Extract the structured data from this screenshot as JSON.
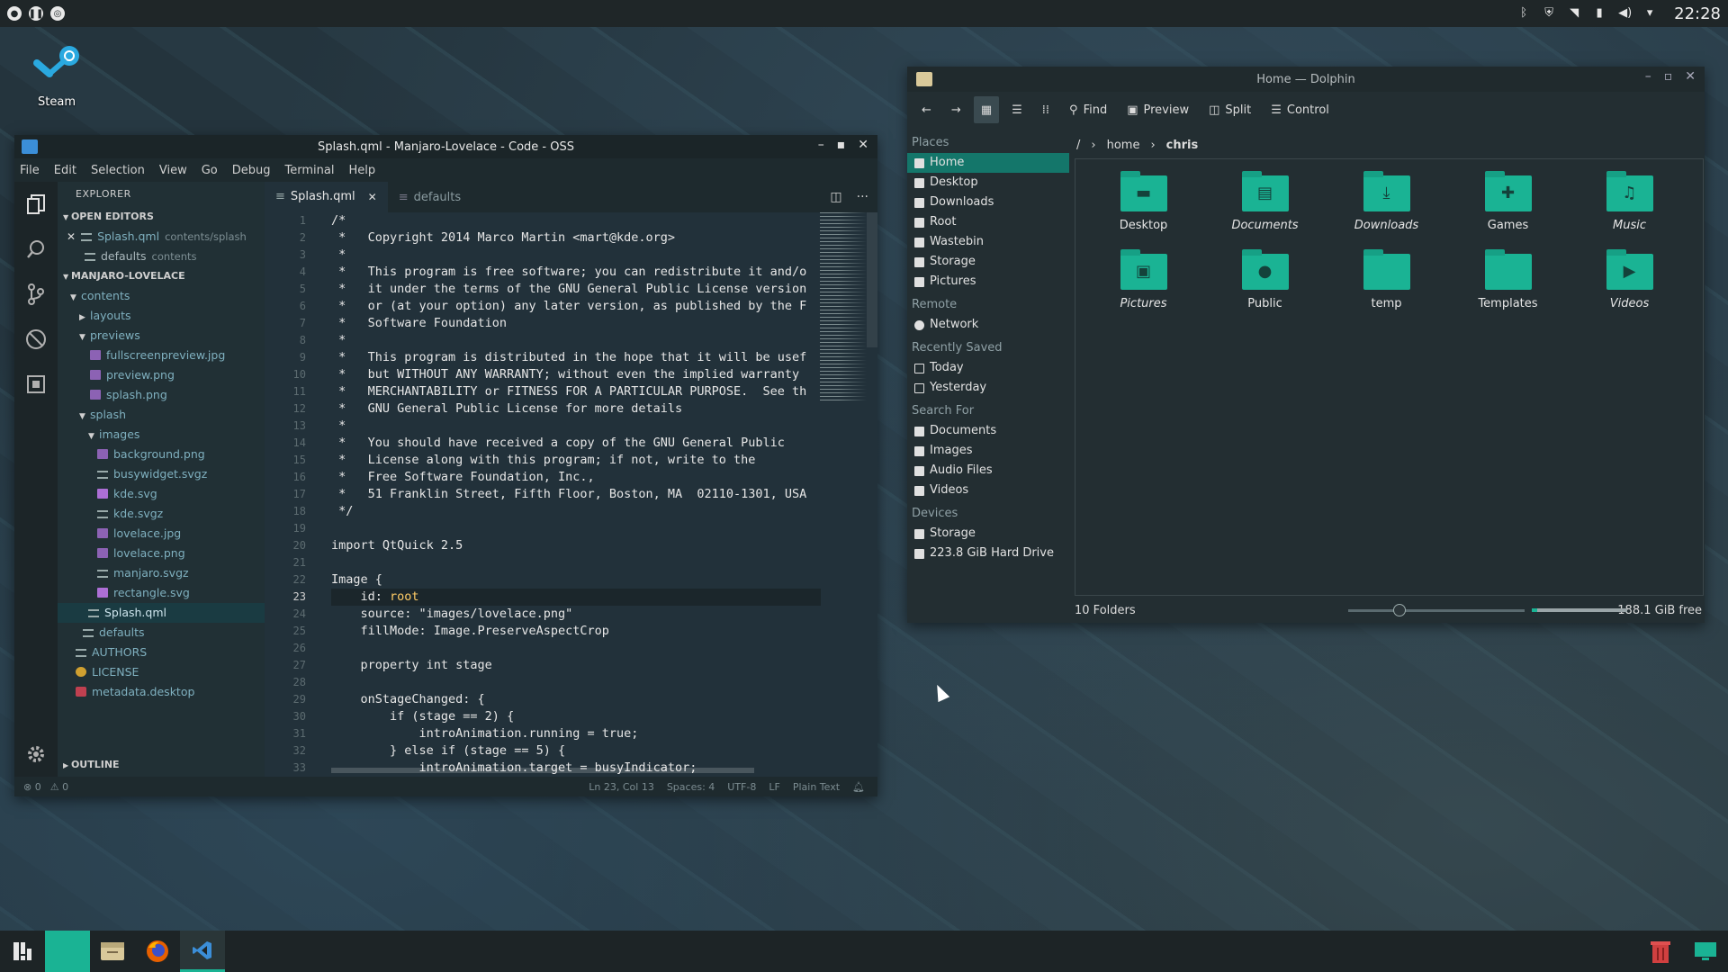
{
  "top_panel": {
    "clock": "22:28"
  },
  "desktop": {
    "steam_label": "Steam"
  },
  "code_window": {
    "title": "Splash.qml - Manjaro-Lovelace - Code - OSS",
    "menu": [
      "File",
      "Edit",
      "Selection",
      "View",
      "Go",
      "Debug",
      "Terminal",
      "Help"
    ],
    "explorer_header": "EXPLORER",
    "open_editors_label": "OPEN EDITORS",
    "open_editors": [
      {
        "name": "Splash.qml",
        "path": "contents/splash"
      },
      {
        "name": "defaults",
        "path": "contents"
      }
    ],
    "project_label": "MANJARO-LOVELACE",
    "tree": [
      {
        "label": "contents"
      },
      {
        "label": "layouts"
      },
      {
        "label": "previews"
      },
      {
        "label": "fullscreenpreview.jpg"
      },
      {
        "label": "preview.png"
      },
      {
        "label": "splash.png"
      },
      {
        "label": "splash"
      },
      {
        "label": "images"
      },
      {
        "label": "background.png"
      },
      {
        "label": "busywidget.svgz"
      },
      {
        "label": "kde.svg"
      },
      {
        "label": "kde.svgz"
      },
      {
        "label": "lovelace.jpg"
      },
      {
        "label": "lovelace.png"
      },
      {
        "label": "manjaro.svgz"
      },
      {
        "label": "rectangle.svg"
      },
      {
        "label": "Splash.qml"
      },
      {
        "label": "defaults"
      },
      {
        "label": "AUTHORS"
      },
      {
        "label": "LICENSE"
      },
      {
        "label": "metadata.desktop"
      }
    ],
    "outline_label": "OUTLINE",
    "tabs": [
      {
        "label": "Splash.qml"
      },
      {
        "label": "defaults"
      }
    ],
    "line_numbers": [
      "1",
      "2",
      "3",
      "4",
      "5",
      "6",
      "7",
      "8",
      "9",
      "10",
      "11",
      "12",
      "13",
      "14",
      "15",
      "16",
      "17",
      "18",
      "19",
      "20",
      "21",
      "22",
      "23",
      "24",
      "25",
      "26",
      "27",
      "28",
      "29",
      "30",
      "31",
      "32",
      "33"
    ],
    "code_lines": [
      "/*",
      " *   Copyright 2014 Marco Martin <mart@kde.org>",
      " *",
      " *   This program is free software; you can redistribute it and/o",
      " *   it under the terms of the GNU General Public License version",
      " *   or (at your option) any later version, as published by the F",
      " *   Software Foundation",
      " *",
      " *   This program is distributed in the hope that it will be usef",
      " *   but WITHOUT ANY WARRANTY; without even the implied warranty",
      " *   MERCHANTABILITY or FITNESS FOR A PARTICULAR PURPOSE.  See th",
      " *   GNU General Public License for more details",
      " *",
      " *   You should have received a copy of the GNU General Public",
      " *   License along with this program; if not, write to the",
      " *   Free Software Foundation, Inc.,",
      " *   51 Franklin Street, Fifth Floor, Boston, MA  02110-1301, USA",
      " */",
      "",
      "import QtQuick 2.5",
      "",
      "Image {",
      "    id: root",
      "    source: \"images/lovelace.png\"",
      "    fillMode: Image.PreserveAspectCrop",
      "",
      "    property int stage",
      "",
      "    onStageChanged: {",
      "        if (stage == 2) {",
      "            introAnimation.running = true;",
      "        } else if (stage == 5) {",
      "            introAnimation.target = busyIndicator;"
    ],
    "status": {
      "errors": "0",
      "warnings": "0",
      "position": "Ln 23, Col 13",
      "spaces": "Spaces: 4",
      "encoding": "UTF-8",
      "eol": "LF",
      "language": "Plain Text"
    }
  },
  "dolphin": {
    "title": "Home — Dolphin",
    "toolbar": {
      "find": "Find",
      "preview": "Preview",
      "split": "Split",
      "control": "Control"
    },
    "places": [
      {
        "header": "Places",
        "items": [
          "Home",
          "Desktop",
          "Downloads",
          "Root",
          "Wastebin",
          "Storage",
          "Pictures"
        ]
      },
      {
        "header": "Remote",
        "items": [
          "Network"
        ]
      },
      {
        "header": "Recently Saved",
        "items": [
          "Today",
          "Yesterday"
        ]
      },
      {
        "header": "Search For",
        "items": [
          "Documents",
          "Images",
          "Audio Files",
          "Videos"
        ]
      },
      {
        "header": "Devices",
        "items": [
          "Storage",
          "223.8 GiB Hard Drive"
        ]
      }
    ],
    "breadcrumb": [
      "/",
      "home",
      "chris"
    ],
    "folders": [
      {
        "name": "Desktop"
      },
      {
        "name": "Documents"
      },
      {
        "name": "Downloads"
      },
      {
        "name": "Games"
      },
      {
        "name": "Music"
      },
      {
        "name": "Pictures"
      },
      {
        "name": "Public"
      },
      {
        "name": "temp"
      },
      {
        "name": "Templates"
      },
      {
        "name": "Videos"
      }
    ],
    "status_left": "10 Folders",
    "free_space": "188.1 GiB free",
    "disk_used_fraction": 0.06
  },
  "colors": {
    "accent": "#1ab394",
    "selection": "#14766a",
    "code_keyword": "#ffcc66"
  }
}
